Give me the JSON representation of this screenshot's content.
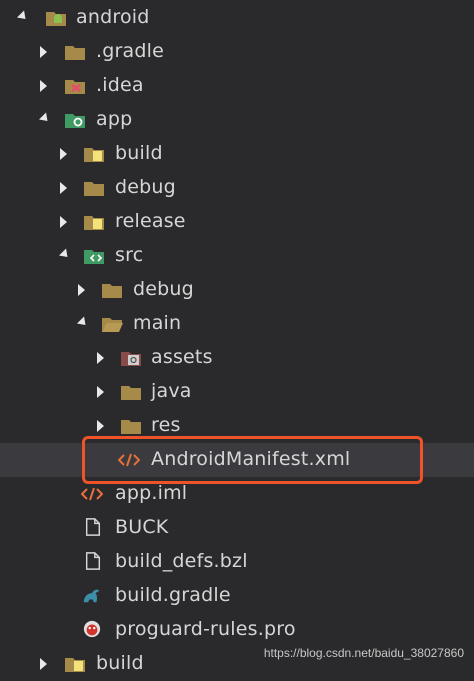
{
  "tree": {
    "items": [
      {
        "label": "android",
        "icon": "android-folder-icon",
        "state": "expanded"
      },
      {
        "label": ".gradle",
        "icon": "folder-icon",
        "state": "collapsed"
      },
      {
        "label": ".idea",
        "icon": "idea-folder-icon",
        "state": "collapsed"
      },
      {
        "label": "app",
        "icon": "app-folder-icon",
        "state": "expanded"
      },
      {
        "label": "build",
        "icon": "build-folder-icon",
        "state": "collapsed"
      },
      {
        "label": "debug",
        "icon": "folder-icon",
        "state": "collapsed"
      },
      {
        "label": "release",
        "icon": "build-folder-icon",
        "state": "collapsed"
      },
      {
        "label": "src",
        "icon": "src-folder-icon",
        "state": "expanded"
      },
      {
        "label": "debug",
        "icon": "folder-icon",
        "state": "collapsed"
      },
      {
        "label": "main",
        "icon": "folder-open-icon",
        "state": "expanded"
      },
      {
        "label": "assets",
        "icon": "assets-folder-icon",
        "state": "collapsed"
      },
      {
        "label": "java",
        "icon": "folder-icon",
        "state": "collapsed"
      },
      {
        "label": "res",
        "icon": "folder-icon",
        "state": "collapsed"
      },
      {
        "label": "AndroidManifest.xml",
        "icon": "xml-file-icon",
        "state": "file",
        "selected": true
      },
      {
        "label": "app.iml",
        "icon": "xml-file-icon",
        "state": "file"
      },
      {
        "label": "BUCK",
        "icon": "file-icon",
        "state": "file"
      },
      {
        "label": "build_defs.bzl",
        "icon": "file-icon",
        "state": "file"
      },
      {
        "label": "build.gradle",
        "icon": "gradle-icon",
        "state": "file"
      },
      {
        "label": "proguard-rules.pro",
        "icon": "proguard-icon",
        "state": "file"
      },
      {
        "label": "build",
        "icon": "build-folder-icon",
        "state": "collapsed"
      }
    ]
  },
  "watermark": "https://blog.csdn.net/baidu_38027860",
  "colors": {
    "background": "#2a2a2c",
    "selected_row": "#3a3a3f",
    "highlight_border": "#f0522a",
    "folder": "#a58a4a",
    "text": "#d6d6d6"
  }
}
